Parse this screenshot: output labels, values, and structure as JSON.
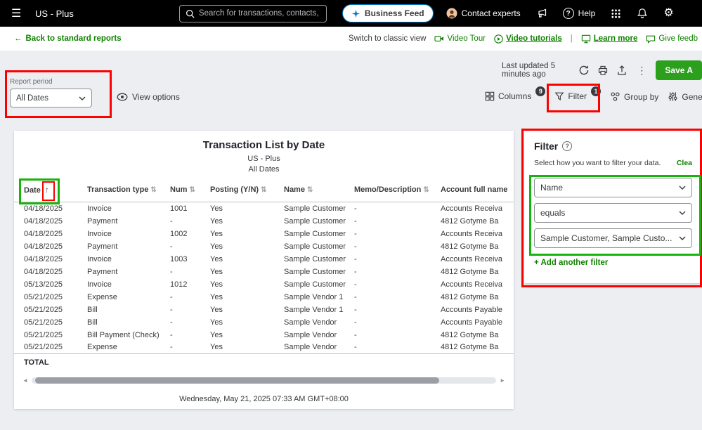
{
  "icons": {
    "hamburger": "☰",
    "back_arrow": "←",
    "help_q": "?",
    "info_q": "?",
    "gear": "⚙",
    "kebab": "⋮",
    "pipe": "|",
    "sort_both": "⇅",
    "sort_up": "↑",
    "scroll_left": "◄",
    "scroll_right": "►"
  },
  "topbar": {
    "company": "US - Plus",
    "search_placeholder": "Search for transactions, contacts,",
    "business_feed": "Business Feed",
    "contact_experts": "Contact experts",
    "help": "Help"
  },
  "subheader": {
    "back_link": "Back to standard reports",
    "switch_classic": "Switch to classic view",
    "video_tour": "Video Tour",
    "video_tutorials": "Video tutorials",
    "learn_more": "Learn more",
    "give_feedback": "Give feedb"
  },
  "actions": {
    "last_updated": "Last updated 5 minutes ago",
    "save": "Save A"
  },
  "toolbar": {
    "report_period_label": "Report period",
    "report_period_value": "All Dates",
    "view_options": "View options",
    "columns": "Columns",
    "columns_badge": "9",
    "filter": "Filter",
    "filter_badge": "1",
    "group_by": "Group by",
    "general_options": "General opti"
  },
  "report": {
    "title": "Transaction List by Date",
    "company": "US - Plus",
    "period": "All Dates",
    "columns": [
      "Date",
      "Transaction type",
      "Num",
      "Posting (Y/N)",
      "Name",
      "Memo/Description",
      "Account full name"
    ],
    "rows": [
      [
        "04/18/2025",
        "Invoice",
        "1001",
        "Yes",
        "Sample Customer",
        "-",
        "Accounts Receiva"
      ],
      [
        "04/18/2025",
        "Payment",
        "-",
        "Yes",
        "Sample Customer",
        "-",
        "4812 Gotyme Ba"
      ],
      [
        "04/18/2025",
        "Invoice",
        "1002",
        "Yes",
        "Sample Customer",
        "-",
        "Accounts Receiva"
      ],
      [
        "04/18/2025",
        "Payment",
        "-",
        "Yes",
        "Sample Customer",
        "-",
        "4812 Gotyme Ba"
      ],
      [
        "04/18/2025",
        "Invoice",
        "1003",
        "Yes",
        "Sample Customer",
        "-",
        "Accounts Receiva"
      ],
      [
        "04/18/2025",
        "Payment",
        "-",
        "Yes",
        "Sample Customer",
        "-",
        "4812 Gotyme Ba"
      ],
      [
        "05/13/2025",
        "Invoice",
        "1012",
        "Yes",
        "Sample Customer",
        "-",
        "Accounts Receiva"
      ],
      [
        "05/21/2025",
        "Expense",
        "-",
        "Yes",
        "Sample Vendor 1",
        "-",
        "4812 Gotyme Ba"
      ],
      [
        "05/21/2025",
        "Bill",
        "-",
        "Yes",
        "Sample Vendor 1",
        "-",
        "Accounts Payable"
      ],
      [
        "05/21/2025",
        "Bill",
        "-",
        "Yes",
        "Sample Vendor",
        "-",
        "Accounts Payable"
      ],
      [
        "05/21/2025",
        "Bill Payment (Check)",
        "-",
        "Yes",
        "Sample Vendor",
        "-",
        "4812 Gotyme Ba"
      ],
      [
        "05/21/2025",
        "Expense",
        "-",
        "Yes",
        "Sample Vendor",
        "-",
        "4812 Gotyme Ba"
      ]
    ],
    "total_label": "TOTAL",
    "footer": "Wednesday, May 21, 2025 07:33 AM GMT+08:00"
  },
  "filter_panel": {
    "title": "Filter",
    "subtitle": "Select how you want to filter your data.",
    "clear": "Clea",
    "field": "Name",
    "operator": "equals",
    "value": "Sample Customer, Sample Custo...",
    "add_filter": "+ Add another filter"
  },
  "colors": {
    "brand_green": "#2ca01c",
    "link_green": "#108000",
    "business_feed_blue": "#0077c5",
    "badge_navy": "#393a3d",
    "annotation_red": "#fe0000",
    "annotation_green": "#17b50c"
  }
}
